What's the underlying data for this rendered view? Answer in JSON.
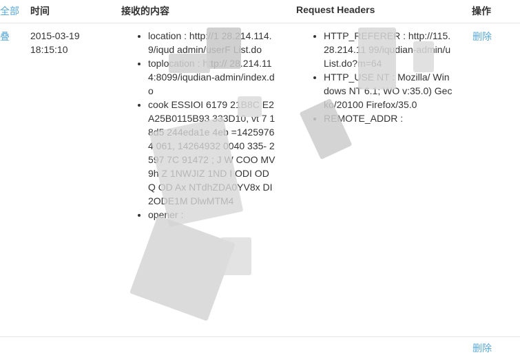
{
  "table": {
    "headers": {
      "select": "全部",
      "time": "时间",
      "content": "接收的内容",
      "request_headers": "Request Headers",
      "action": "操作"
    },
    "rows": [
      {
        "collapse_label": "叠",
        "date": "2015-03-19",
        "time": "18:15:10",
        "content_items": [
          "location : http://1 28.214.114. 9/iqud admin/userF List.do",
          "toplocation : http:// 28.214.114:8099/iqudian-admin/index.do",
          "cook ESSIOI 6179 21B8C E2A25B0115B93 333D10, vt 7 18d5 244eda1e 4eb =14259764 061, 14264932 0040 335- 2597 7C 91472 ; J W COO MV9h Z 1NWJIZ 1ND I ODI OD Q OD Ax NTdhZDA0YV8x DI2ODE1M DlwMTM4",
          "opener :"
        ],
        "header_items": [
          "HTTP_REFERER : http://115.28.214.11 99/iqudian-admin/u List.do?m=64",
          "HTTP_USE NT : Mozilla/ Windows NT 6.1; WO v:35.0) Gecko/20100 Firefox/35.0",
          "REMOTE_ADDR :"
        ],
        "delete_label": "删除"
      }
    ],
    "next_row_delete_label": "删除"
  }
}
